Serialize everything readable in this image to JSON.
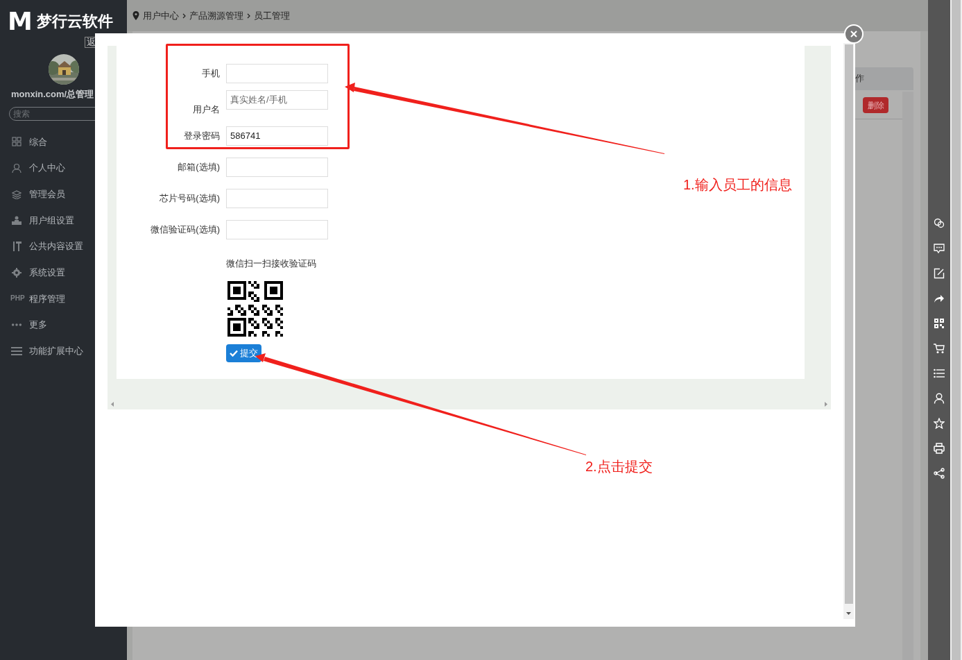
{
  "brand": {
    "logo_mark": "M",
    "name": "梦行云软件",
    "back_link": "返"
  },
  "user": {
    "name": "monxin.com/总管理"
  },
  "sidebar": {
    "search": {
      "placeholder": "搜索"
    },
    "items": [
      {
        "label": "综合"
      },
      {
        "label": "个人中心"
      },
      {
        "label": "管理会员"
      },
      {
        "label": "用户组设置"
      },
      {
        "label": "公共内容设置"
      },
      {
        "label": "系统设置"
      },
      {
        "label": "程序管理",
        "icon_label": "PHP"
      },
      {
        "label": "更多"
      },
      {
        "label": "功能扩展中心"
      }
    ]
  },
  "breadcrumb": [
    "用户中心",
    "产品溯源管理",
    "员工管理"
  ],
  "background_table": {
    "column_header": "作",
    "delete_button": "删除"
  },
  "dialog": {
    "form": [
      {
        "label": "手机"
      },
      {
        "label": "用户名",
        "placeholder": "真实姓名/手机"
      },
      {
        "label": "登录密码",
        "value": "586741"
      },
      {
        "label": "邮箱(选填)"
      },
      {
        "label": "芯片号码(选填)"
      },
      {
        "label": "微信验证码(选填)"
      }
    ],
    "qr_caption": "微信扫一扫接收验证码",
    "submit_button": "提交"
  },
  "annotations": [
    "1.输入员工的信息",
    "2.点击提交"
  ]
}
